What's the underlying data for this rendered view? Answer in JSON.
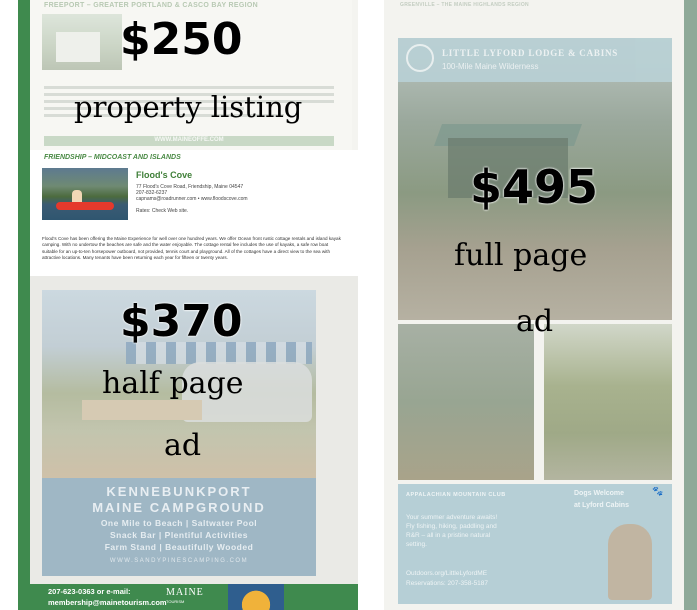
{
  "left_page": {
    "top_listing": {
      "region": "FREEPORT – GREATER PORTLAND & CASCO BAY REGION",
      "footer": "WWW.MAINEOFFE.COM"
    },
    "floods": {
      "region": "FRIENDSHIP – MIDCOAST AND ISLANDS",
      "title": "Flood's Cove",
      "address": "77 Flood's Cove Road, Friendship, Maine 04547",
      "phone": "207-832-6237",
      "web": "capnams@roadrunner.com • www.floodscove.com",
      "rates": "Rates: Check Web site.",
      "body": "Flood's Cove has been offering the Maine Experience for well over one hundred years. We offer Ocean front rustic cottage rentals and island kayak camping. With no undertow the beaches are safe and the water enjoyable. The cottage rental fee includes the use of kayaks, a safe row boat suitable for an up-to-ten horsepower outboard, not provided, tennis court and playground. All of the cottages have a direct view to the sea with attractive locations. Many tenants have been returning each year for fifteen or twenty years."
    },
    "half_ad": {
      "line1": "KENNEBUNKPORT",
      "line2": "MAINE CAMPGROUND",
      "line3": "One Mile to Beach | Saltwater Pool",
      "line4": "Snack Bar | Plentiful Activities",
      "line5": "Farm Stand | Beautifully Wooded",
      "url": "WWW.SANDYPINESCAMPING.COM"
    },
    "bottom_bar": {
      "phone": "207-623-0363 or e-mail:",
      "email": "membership@mainetourism.com",
      "logo": "MAINE",
      "logo_sub": "TOURISM"
    }
  },
  "right_page": {
    "region": "GREENVILLE – THE MAINE HIGHLANDS REGION",
    "banner_title": "LITTLE LYFORD LODGE & CABINS",
    "banner_sub": "100-Mile Maine Wilderness",
    "amc": "APPALACHIAN MOUNTAIN CLUB",
    "advert_lines": [
      "Your summer adventure awaits!",
      "Fly fishing, hiking, paddling and",
      "R&R – all in a pristine natural",
      "setting."
    ],
    "contact_lines": [
      "Outdoors.org/LittleLyfordME",
      "Reservations: 207-358-5187"
    ],
    "dogs_line1": "Dogs Welcome",
    "dogs_line2": "at Lyford Cabins"
  },
  "overlays": {
    "listing": {
      "price": "$250",
      "label": "property listing"
    },
    "half": {
      "price": "$370",
      "label1": "half page",
      "label2": "ad"
    },
    "full": {
      "price": "$495",
      "label1": "full page",
      "label2": "ad"
    }
  }
}
